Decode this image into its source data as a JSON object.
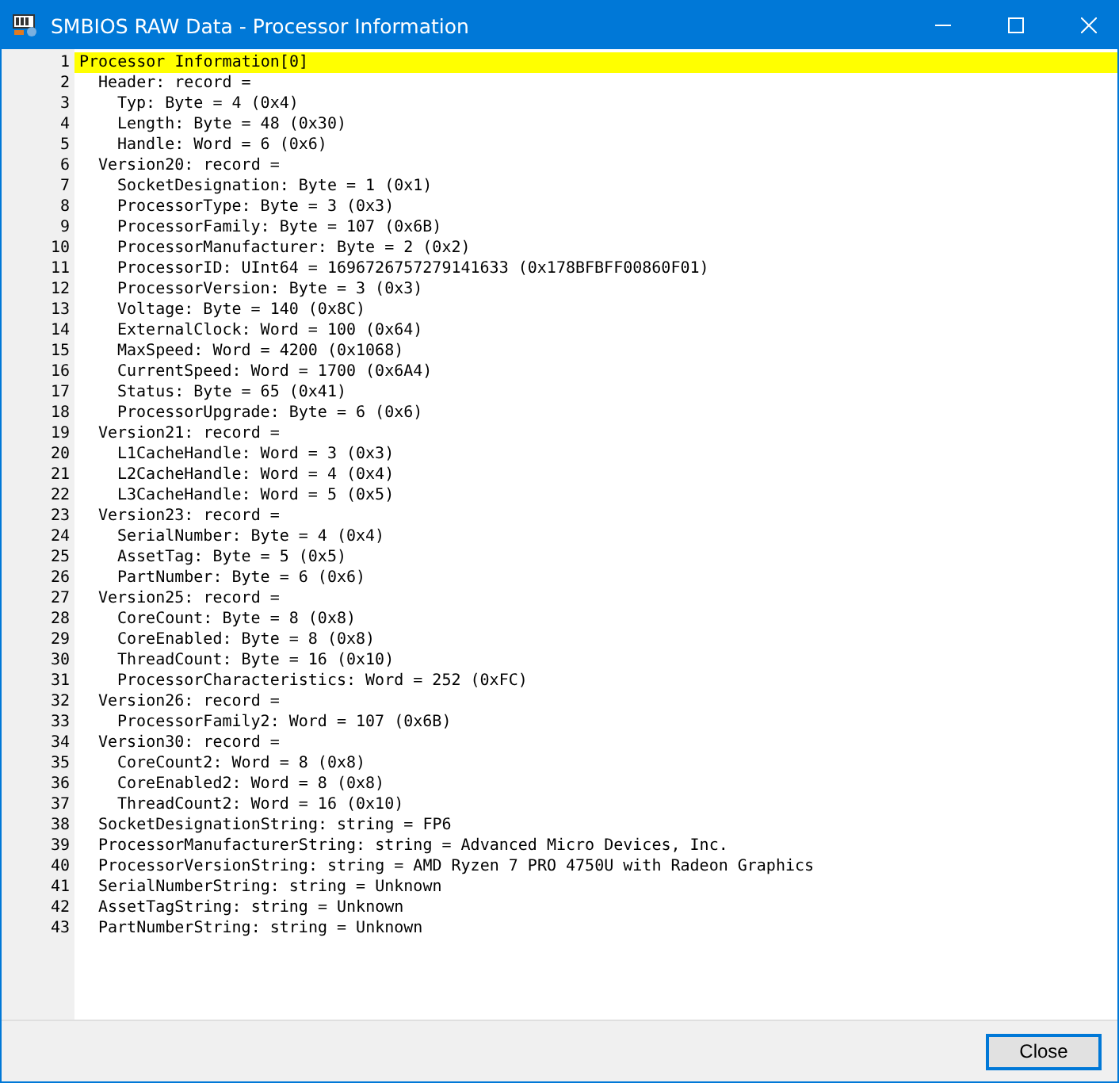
{
  "window": {
    "title": "SMBIOS RAW Data - Processor Information"
  },
  "lines": [
    {
      "number": "1",
      "text": "Processor Information[0]",
      "selected": true,
      "children": [
        {
          "number": "2",
          "text": "Header: record =",
          "selected": false,
          "children": [
            {
              "number": "3",
              "text": "Typ: Byte = 4 (0x4)",
              "selected": false
            },
            {
              "number": "4",
              "text": "Length: Byte = 48 (0x30)",
              "selected": false
            },
            {
              "number": "5",
              "text": "Handle: Word = 6 (0x6)",
              "selected": false
            }
          ]
        },
        {
          "number": "6",
          "text": "Version20: record =",
          "selected": false,
          "children": [
            {
              "number": "7",
              "text": "SocketDesignation: Byte = 1 (0x1)",
              "selected": false
            },
            {
              "number": "8",
              "text": "ProcessorType: Byte = 3 (0x3)",
              "selected": false
            },
            {
              "number": "9",
              "text": "ProcessorFamily: Byte = 107 (0x6B)",
              "selected": false
            },
            {
              "number": "10",
              "text": "ProcessorManufacturer: Byte = 2 (0x2)",
              "selected": false
            },
            {
              "number": "11",
              "text": "ProcessorID: UInt64 = 1696726757279141633 (0x178BFBFF00860F01)",
              "selected": false
            },
            {
              "number": "12",
              "text": "ProcessorVersion: Byte = 3 (0x3)",
              "selected": false
            },
            {
              "number": "13",
              "text": "Voltage: Byte = 140 (0x8C)",
              "selected": false
            },
            {
              "number": "14",
              "text": "ExternalClock: Word = 100 (0x64)",
              "selected": false
            },
            {
              "number": "15",
              "text": "MaxSpeed: Word = 4200 (0x1068)",
              "selected": false
            },
            {
              "number": "16",
              "text": "CurrentSpeed: Word = 1700 (0x6A4)",
              "selected": false
            },
            {
              "number": "17",
              "text": "Status: Byte = 65 (0x41)",
              "selected": false
            },
            {
              "number": "18",
              "text": "ProcessorUpgrade: Byte = 6 (0x6)",
              "selected": false
            }
          ]
        },
        {
          "number": "19",
          "text": "Version21: record =",
          "selected": false,
          "children": [
            {
              "number": "20",
              "text": "L1CacheHandle: Word = 3 (0x3)",
              "selected": false
            },
            {
              "number": "21",
              "text": "L2CacheHandle: Word = 4 (0x4)",
              "selected": false
            },
            {
              "number": "22",
              "text": "L3CacheHandle: Word = 5 (0x5)",
              "selected": false
            }
          ]
        },
        {
          "number": "23",
          "text": "Version23: record =",
          "selected": false,
          "children": [
            {
              "number": "24",
              "text": "SerialNumber: Byte = 4 (0x4)",
              "selected": false
            },
            {
              "number": "25",
              "text": "AssetTag: Byte = 5 (0x5)",
              "selected": false
            },
            {
              "number": "26",
              "text": "PartNumber: Byte = 6 (0x6)",
              "selected": false
            }
          ]
        },
        {
          "number": "27",
          "text": "Version25: record =",
          "selected": false,
          "children": [
            {
              "number": "28",
              "text": "CoreCount: Byte = 8 (0x8)",
              "selected": false
            },
            {
              "number": "29",
              "text": "CoreEnabled: Byte = 8 (0x8)",
              "selected": false
            },
            {
              "number": "30",
              "text": "ThreadCount: Byte = 16 (0x10)",
              "selected": false
            },
            {
              "number": "31",
              "text": "ProcessorCharacteristics: Word = 252 (0xFC)",
              "selected": false
            }
          ]
        },
        {
          "number": "32",
          "text": "Version26: record =",
          "selected": false,
          "children": [
            {
              "number": "33",
              "text": "ProcessorFamily2: Word = 107 (0x6B)",
              "selected": false
            }
          ]
        },
        {
          "number": "34",
          "text": "Version30: record =",
          "selected": false,
          "children": [
            {
              "number": "35",
              "text": "CoreCount2: Word = 8 (0x8)",
              "selected": false
            },
            {
              "number": "36",
              "text": "CoreEnabled2: Word = 8 (0x8)",
              "selected": false
            },
            {
              "number": "37",
              "text": "ThreadCount2: Word = 16 (0x10)",
              "selected": false
            }
          ]
        },
        {
          "number": "38",
          "text": "SocketDesignationString: string = FP6",
          "selected": false
        },
        {
          "number": "39",
          "text": "ProcessorManufacturerString: string = Advanced Micro Devices, Inc.",
          "selected": false
        },
        {
          "number": "40",
          "text": "ProcessorVersionString: string = AMD Ryzen 7 PRO 4750U with Radeon Graphics",
          "selected": false
        },
        {
          "number": "41",
          "text": "SerialNumberString: string = Unknown",
          "selected": false
        },
        {
          "number": "42",
          "text": "AssetTagString: string = Unknown",
          "selected": false
        },
        {
          "number": "43",
          "text": "PartNumberString: string = Unknown",
          "selected": false
        }
      ]
    }
  ],
  "buttons": [
    {
      "label": "Close"
    }
  ]
}
